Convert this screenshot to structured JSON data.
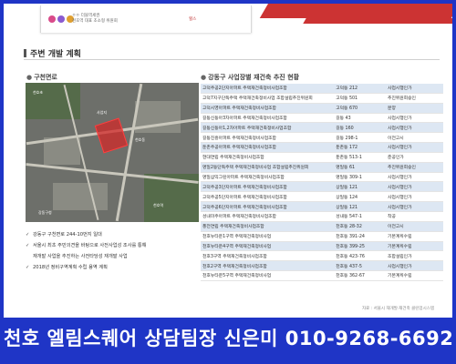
{
  "banner": {
    "text_line1": "ㅇㅇ 더블역세권",
    "text_line2": "천호역 대표 초소형 위원회",
    "badge": "힐스"
  },
  "section": {
    "title": "주변 개발 계획"
  },
  "left": {
    "heading": "구천면로",
    "map": {
      "labels": [
        "천호초",
        "천호동",
        "천호역",
        "강동구청"
      ],
      "site": "사업지"
    },
    "bullets": [
      "강동구 구천면로 244-10번지 일대",
      "서울시 최초 주민의견을 바탕으로 사전사업성 조사를 통해",
      "재개발 사업을 추진하는 사전타당성 재개발 사업",
      "2018년 정비구역계획 수립 용역 계획"
    ],
    "bullet_flags": [
      true,
      true,
      false,
      true
    ]
  },
  "right": {
    "heading": "강동구 사업장별 재건축 추진 현황",
    "rows": [
      {
        "name": "고덕주공2단지아파트 주택재건축정비사업조합",
        "location": "고덕동 212",
        "status": "사업시행인가",
        "highlight": true
      },
      {
        "name": "고덕7지구단독주택 주택재건축정비사업 조합설립추진위원회",
        "location": "고덕동 501",
        "status": "추진위원회승인",
        "highlight": false
      },
      {
        "name": "고덕시영아파트 주택재건축정비사업조합",
        "location": "고덕동 670",
        "status": "분양",
        "highlight": true
      },
      {
        "name": "길동신동아3차아파트 주택재건축정비사업조합",
        "location": "길동 43",
        "status": "사업시행인가",
        "highlight": false
      },
      {
        "name": "길동신동아1,2차아파트 주택재건축정비사업조합",
        "location": "길동 160",
        "status": "사업시행인가",
        "highlight": true
      },
      {
        "name": "길동진흥아파트 주택재건축정비사업조합",
        "location": "길동 298-1",
        "status": "이전고시",
        "highlight": false
      },
      {
        "name": "둔촌주공아파트 주택재건축정비사업조합",
        "location": "둔촌동 172",
        "status": "사업시행인가",
        "highlight": true
      },
      {
        "name": "현대연립 주택재건축정비사업조합",
        "location": "둔촌동 513-1",
        "status": "준공인가",
        "highlight": false
      },
      {
        "name": "명일2동단독주택 주택재건축정비사업 조합설립추진위원회",
        "location": "명일동 61",
        "status": "추진위원회승인",
        "highlight": true
      },
      {
        "name": "명일삼익그린아파트 주택재건축정비사업조합",
        "location": "명일동 309-1",
        "status": "사업시행인가",
        "highlight": false
      },
      {
        "name": "고덕주공3단지아파트 주택재건축정비사업조합",
        "location": "상일동 121",
        "status": "사업시행인가",
        "highlight": true
      },
      {
        "name": "고덕주공5단지아파트 주택재건축정비사업조합",
        "location": "상일동 124",
        "status": "사업시행인가",
        "highlight": false
      },
      {
        "name": "고덕주공6단지아파트 주택재건축정비사업조합",
        "location": "상일동 121",
        "status": "사업시행인가",
        "highlight": true
      },
      {
        "name": "성내미주아파트 주택재건축정비사업조합",
        "location": "성내동 547-1",
        "status": "착공",
        "highlight": false
      },
      {
        "name": "풍전연립 주택재건축정비사업조합",
        "location": "천호동 28-32",
        "status": "이전고시",
        "highlight": true
      },
      {
        "name": "천호뉴타운1구역 주택재건축정비사업",
        "location": "천호동 391-24",
        "status": "기본계획수립",
        "highlight": false
      },
      {
        "name": "천호뉴타운4구역 주택재건축정비사업",
        "location": "천호동 399-25",
        "status": "기본계획수립",
        "highlight": true
      },
      {
        "name": "천호3구역 주택재건축정비사업조합",
        "location": "천호동 423-76",
        "status": "조합설립인가",
        "highlight": false
      },
      {
        "name": "천호2구역 주택재건축정비사업조합",
        "location": "천호동 437-5",
        "status": "사업시행인가",
        "highlight": true
      },
      {
        "name": "천호뉴타운5구역 주택재건축정비사업",
        "location": "천호동 362-67",
        "status": "기본계획수립",
        "highlight": false
      }
    ],
    "source": "자료 : 서울시 재개발·재건축 클린업시스템"
  },
  "footer": {
    "text": "천호 엘림스퀘어 상담팀장 신은미 010-9268-6692"
  },
  "colors": {
    "frame_border": "#1f35c6",
    "footer_bg": "#1f35c6",
    "row_highlight": "#dde7f3",
    "site_area": "#d22828"
  }
}
